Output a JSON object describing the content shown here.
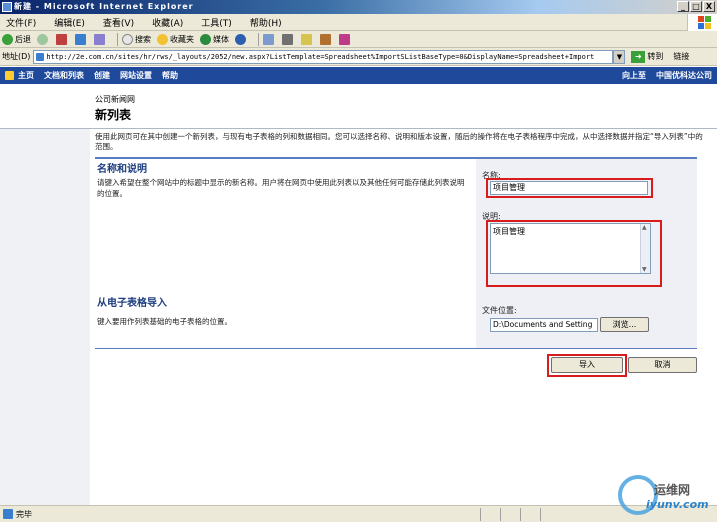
{
  "window": {
    "title": "新建 - Microsoft Internet Explorer",
    "minimize": "_",
    "maximize": "□",
    "close": "X"
  },
  "menubar": {
    "items": [
      "文件(F)",
      "编辑(E)",
      "查看(V)",
      "收藏(A)",
      "工具(T)",
      "帮助(H)"
    ]
  },
  "toolbar": {
    "back": "后退",
    "forward": "",
    "search": "搜索",
    "favorites": "收藏夹",
    "media": "媒体"
  },
  "addressbar": {
    "label": "地址(D)",
    "url": "http://2e.com.cn/sites/hr/rws/_layouts/2052/new.aspx?ListTemplate=Spreadsheet%ImportSListBaseType=0&DisplayName=Spreadsheet+Import",
    "go": "转到",
    "links": "链接"
  },
  "spnav": {
    "items": [
      "主页",
      "文档和列表",
      "创建",
      "网站设置",
      "帮助"
    ],
    "right": [
      "向上至",
      "中国优科达公司"
    ]
  },
  "page": {
    "site_name": "公司新闻网",
    "title": "新列表",
    "description": "使用此网页可在其中创建一个新列表，与现有电子表格的列和数据相同。您可以选择名称、说明和版本设置，随后的操作将在电子表格程序中完成，从中选择数据并指定“导入列表”中的范围。"
  },
  "section_name": {
    "title": "名称和说明",
    "description": "请键入希望在整个网站中的标题中显示的新名称。用户将在网页中使用此列表以及其他任何可能存储此列表说明的位置。",
    "name_label": "名称:",
    "name_value": "项目管理",
    "desc_label": "说明:",
    "desc_value": "项目管理"
  },
  "section_import": {
    "title": "从电子表格导入",
    "description": "键入要用作列表基础的电子表格的位置。",
    "file_label": "文件位置:",
    "file_value": "D:\\Documents and Setting",
    "browse": "浏览..."
  },
  "actions": {
    "import": "导入",
    "cancel": "取消"
  },
  "statusbar": {
    "text": "完毕"
  },
  "watermark": {
    "line1": "运维网",
    "line2": "iyunv.com"
  }
}
